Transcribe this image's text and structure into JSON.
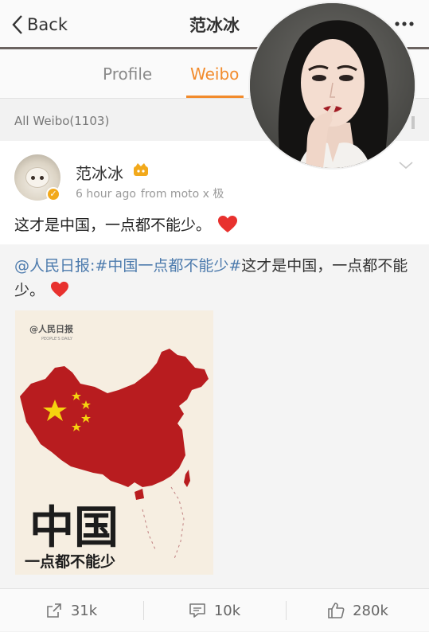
{
  "nav": {
    "back_label": "Back",
    "title": "范冰冰"
  },
  "tabs": {
    "profile": "Profile",
    "weibo": "Weibo",
    "active": "Weibo"
  },
  "all_weibo_label": "All Weibo(1103)",
  "post": {
    "author": "范冰冰",
    "time": "6 hour ago",
    "source": "from moto x 极",
    "text": "这才是中国，一点都不能少。",
    "verified": true
  },
  "repost": {
    "mention": "@人民日报",
    "sep": ":",
    "hashtag": "#中国一点都不能少#",
    "body": "这才是中国，一点都不能少。",
    "image": {
      "logo_text": "@人民日报",
      "logo_sub": "PEOPLE'S DAILY",
      "headline": "中国",
      "slogan": "一点都不能少"
    }
  },
  "actions": {
    "repost_count": "31k",
    "comment_count": "10k",
    "like_count": "280k"
  },
  "colors": {
    "accent": "#f28b2c",
    "link": "#4d7bad",
    "map_red": "#b81c1f",
    "star_yellow": "#f5d30f",
    "heart": "#e8312e"
  },
  "icons": {
    "back": "chevron-left-icon",
    "more": "more-dots-icon",
    "vip": "vip-crown-icon",
    "collapse": "chevron-down-icon",
    "repost": "share-icon",
    "comment": "comment-icon",
    "like": "thumbs-up-icon"
  }
}
